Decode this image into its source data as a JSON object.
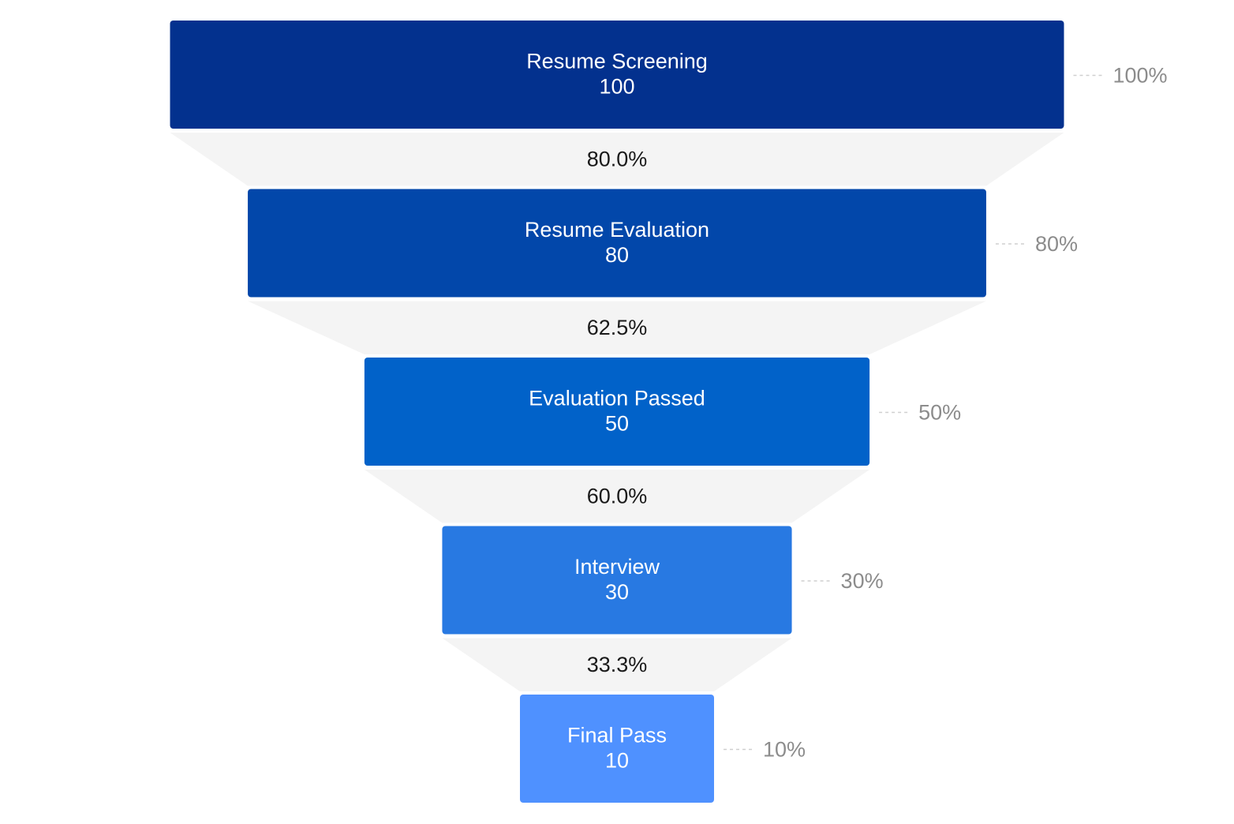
{
  "chart_data": {
    "type": "funnel",
    "stages": [
      {
        "name": "Resume Screening",
        "value": 100,
        "percent": "100%",
        "color": "#03318e"
      },
      {
        "name": "Resume Evaluation",
        "value": 80,
        "percent": "80%",
        "color": "#0247aa"
      },
      {
        "name": "Evaluation Passed",
        "value": 50,
        "percent": "50%",
        "color": "#0162c9"
      },
      {
        "name": "Interview",
        "value": 30,
        "percent": "30%",
        "color": "#2879e2"
      },
      {
        "name": "Final Pass",
        "value": 10,
        "percent": "10%",
        "color": "#4f91ff"
      }
    ],
    "conversions": [
      "80.0%",
      "62.5%",
      "60.0%",
      "33.3%"
    ],
    "connector_color": "#f4f4f4",
    "label_color": "#8c8c8c"
  }
}
